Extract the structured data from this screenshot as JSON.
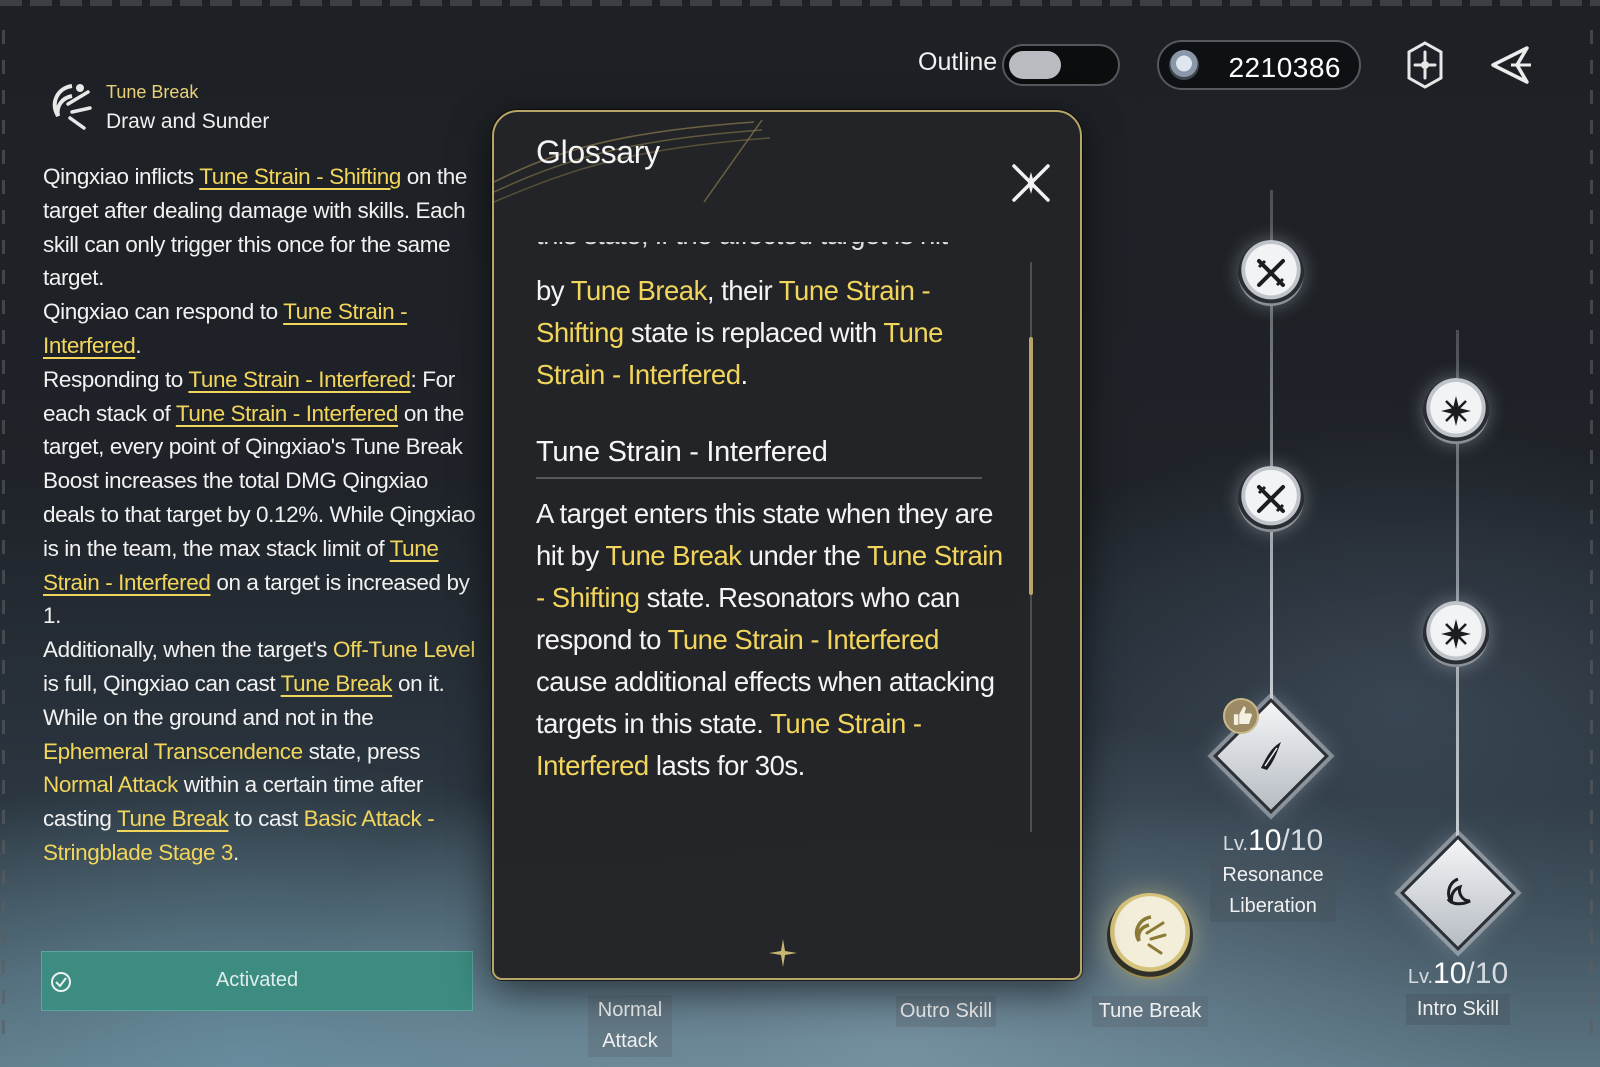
{
  "header": {
    "outline_label": "Outline",
    "outline_enabled": false,
    "currency_value": "2210386",
    "icons": [
      "coin-icon",
      "settings-icon",
      "back-icon"
    ]
  },
  "skill": {
    "type": "Tune Break",
    "name": "Draw and Sunder",
    "description": [
      [
        {
          "t": "Qingxiao inflicts ",
          "s": "plain"
        },
        {
          "t": "Tune Strain - Shifting",
          "s": "link"
        },
        {
          "t": " on the target after dealing damage with skills. Each skill can only trigger this once for the same target.",
          "s": "plain"
        }
      ],
      [
        {
          "t": "Qingxiao can respond to ",
          "s": "plain"
        },
        {
          "t": "Tune Strain - Interfered",
          "s": "link"
        },
        {
          "t": ".",
          "s": "plain"
        }
      ],
      [
        {
          "t": "Responding to ",
          "s": "plain"
        },
        {
          "t": "Tune Strain - Interfered",
          "s": "link"
        },
        {
          "t": ": For each stack of ",
          "s": "plain"
        },
        {
          "t": "Tune Strain - Interfered",
          "s": "link"
        },
        {
          "t": " on the target, every point of Qingxiao's Tune Break Boost increases the total DMG Qingxiao deals to that target by 0.12%. While Qingxiao is in the team, the max stack limit of ",
          "s": "plain"
        },
        {
          "t": "Tune Strain - Interfered",
          "s": "link"
        },
        {
          "t": " on a target is increased by 1.",
          "s": "plain"
        }
      ],
      [
        {
          "t": "Additionally, when the target's ",
          "s": "plain"
        },
        {
          "t": "Off-Tune Level",
          "s": "kw"
        },
        {
          "t": " is full, Qingxiao can cast ",
          "s": "plain"
        },
        {
          "t": "Tune Break",
          "s": "link"
        },
        {
          "t": " on it.",
          "s": "plain"
        }
      ],
      [
        {
          "t": "While on the ground and not in the ",
          "s": "plain"
        },
        {
          "t": "Ephemeral Transcendence",
          "s": "kw"
        },
        {
          "t": " state, press ",
          "s": "plain"
        },
        {
          "t": "Normal Attack",
          "s": "kw"
        },
        {
          "t": " within a certain time after casting ",
          "s": "plain"
        },
        {
          "t": "Tune Break",
          "s": "link"
        },
        {
          "t": " to cast ",
          "s": "plain"
        },
        {
          "t": "Basic Attack - Stringblade Stage 3",
          "s": "kw"
        },
        {
          "t": ".",
          "s": "plain"
        }
      ]
    ],
    "status_label": "Activated"
  },
  "glossary": {
    "title": "Glossary",
    "close_icon": "close-icon",
    "cut_line": "this state, if the affected target is hit",
    "first_entry_tail": [
      {
        "t": "by ",
        "s": "plain"
      },
      {
        "t": "Tune Break",
        "s": "kw"
      },
      {
        "t": ", their ",
        "s": "plain"
      },
      {
        "t": "Tune Strain - Shifting",
        "s": "kw"
      },
      {
        "t": " state is replaced with ",
        "s": "plain"
      },
      {
        "t": "Tune Strain - Interfered",
        "s": "kw"
      },
      {
        "t": ".",
        "s": "plain"
      }
    ],
    "entry_heading": "Tune Strain - Interfered",
    "entry_body": [
      {
        "t": "A target enters this state when they are hit by ",
        "s": "plain"
      },
      {
        "t": "Tune Break",
        "s": "kw"
      },
      {
        "t": " under the ",
        "s": "plain"
      },
      {
        "t": "Tune Strain - Shifting",
        "s": "kw"
      },
      {
        "t": " state. Resonators who can respond to ",
        "s": "plain"
      },
      {
        "t": "Tune Strain - Interfered",
        "s": "kw"
      },
      {
        "t": " cause additional effects when attacking targets in this state. ",
        "s": "plain"
      },
      {
        "t": "Tune Strain - Interfered",
        "s": "kw"
      },
      {
        "t": " lasts for 30s.",
        "s": "plain"
      }
    ]
  },
  "skill_tree": {
    "resonance_liberation": {
      "level_prefix": "Lv.",
      "level": "10",
      "max": "/10",
      "label_line1": "Resonance",
      "label_line2": "Liberation"
    },
    "intro_skill": {
      "level_prefix": "Lv.",
      "level": "10",
      "max": "/10",
      "label": "Intro Skill"
    },
    "normal_attack": {
      "label_line1": "Normal",
      "label_line2": "Attack"
    },
    "outro_skill": {
      "label": "Outro Skill"
    },
    "tune_break": {
      "label": "Tune Break"
    }
  }
}
